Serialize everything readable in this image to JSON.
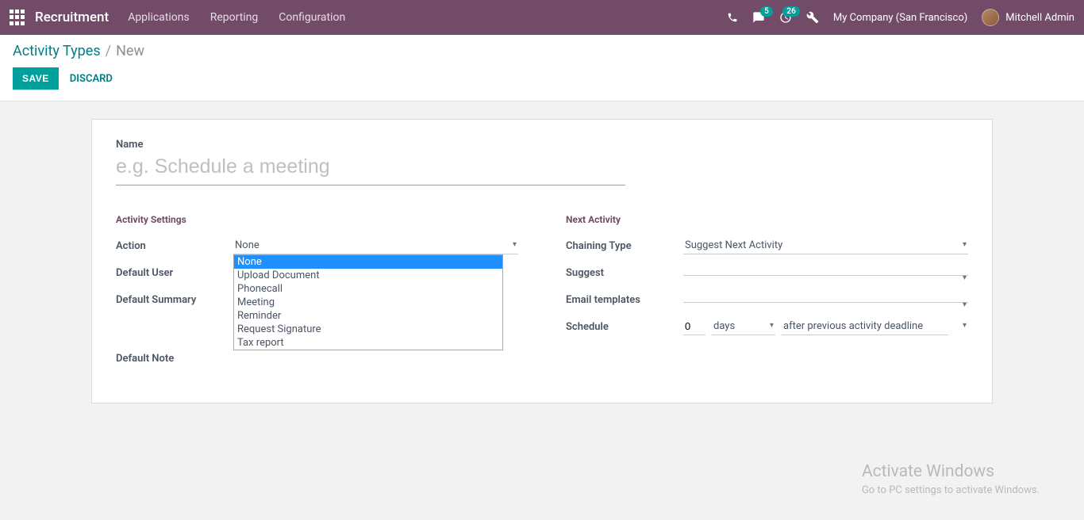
{
  "nav": {
    "brand": "Recruitment",
    "links": [
      "Applications",
      "Reporting",
      "Configuration"
    ],
    "badges": {
      "chat": "5",
      "activity": "26"
    },
    "company": "My Company (San Francisco)",
    "user": "Mitchell Admin"
  },
  "breadcrumb": {
    "parent": "Activity Types",
    "current": "New"
  },
  "buttons": {
    "save": "SAVE",
    "discard": "DISCARD"
  },
  "form": {
    "name_label": "Name",
    "name_placeholder": "e.g. Schedule a meeting",
    "left_section": "Activity Settings",
    "right_section": "Next Activity",
    "labels": {
      "action": "Action",
      "default_user": "Default User",
      "default_summary": "Default Summary",
      "default_note": "Default Note",
      "chaining_type": "Chaining Type",
      "suggest": "Suggest",
      "email_templates": "Email templates",
      "schedule": "Schedule"
    },
    "values": {
      "action": "None",
      "chaining_type": "Suggest Next Activity",
      "schedule_count": "0",
      "schedule_unit": "days",
      "schedule_rel": "after previous activity deadline"
    },
    "action_options": [
      "None",
      "Upload Document",
      "Phonecall",
      "Meeting",
      "Reminder",
      "Request Signature",
      "Tax report"
    ]
  },
  "watermark": {
    "line1": "Activate Windows",
    "line2": "Go to PC settings to activate Windows."
  }
}
